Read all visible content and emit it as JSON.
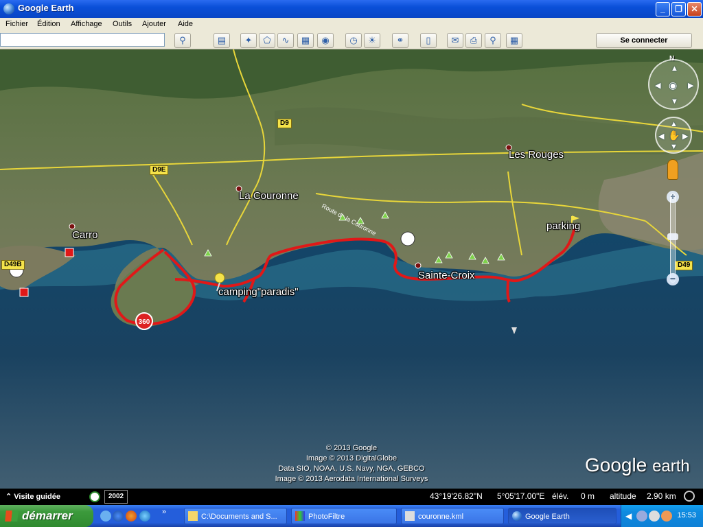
{
  "window": {
    "title": "Google Earth",
    "minimize": "_",
    "maximize": "❐",
    "close": "✕"
  },
  "menu": [
    "Fichier",
    "Édition",
    "Affichage",
    "Outils",
    "Ajouter",
    "Aide"
  ],
  "search": {
    "value": "",
    "placeholder": ""
  },
  "toolbar": {
    "connect_label": "Se connecter"
  },
  "map": {
    "places": {
      "carro": "Carro",
      "la_couronne": "La Couronne",
      "les_rouges": "Les Rouges",
      "parking": "parking",
      "sainte_croix": "Sainte-Croix",
      "camping": "camping\"paradis\""
    },
    "roads": {
      "d9": "D9",
      "d9e": "D9E",
      "d49b": "D49B",
      "d49": "D49"
    },
    "road_label": "Route de la Couronne",
    "marker_360": "360",
    "north": "N",
    "credits": [
      "© 2013 Google",
      "Image © 2013 DigitalGlobe",
      "Data SIO, NOAA, U.S. Navy, NGA, GEBCO",
      "Image © 2013 Aerodata International Surveys"
    ],
    "logo": {
      "part1": "Google",
      "part2": "earth"
    },
    "zoom_plus": "+",
    "zoom_minus": "−"
  },
  "status": {
    "tour_label": "Visite guidée",
    "history_year": "2002",
    "lat": "43°19'26.82\"N",
    "lon": "5°05'17.00\"E",
    "elev_label": "élév.",
    "elev_value": "0 m",
    "alt_label": "altitude",
    "alt_value": "2.90 km"
  },
  "taskbar": {
    "start_label": "démarrer",
    "more": "»",
    "tasks": [
      "C:\\Documents and S...",
      "PhotoFiltre",
      "couronne.kml",
      "Google Earth"
    ],
    "clock": "15:53"
  },
  "colors": {
    "track": "#e01818",
    "road": "#e8d63a",
    "sea": "#1c4466"
  }
}
